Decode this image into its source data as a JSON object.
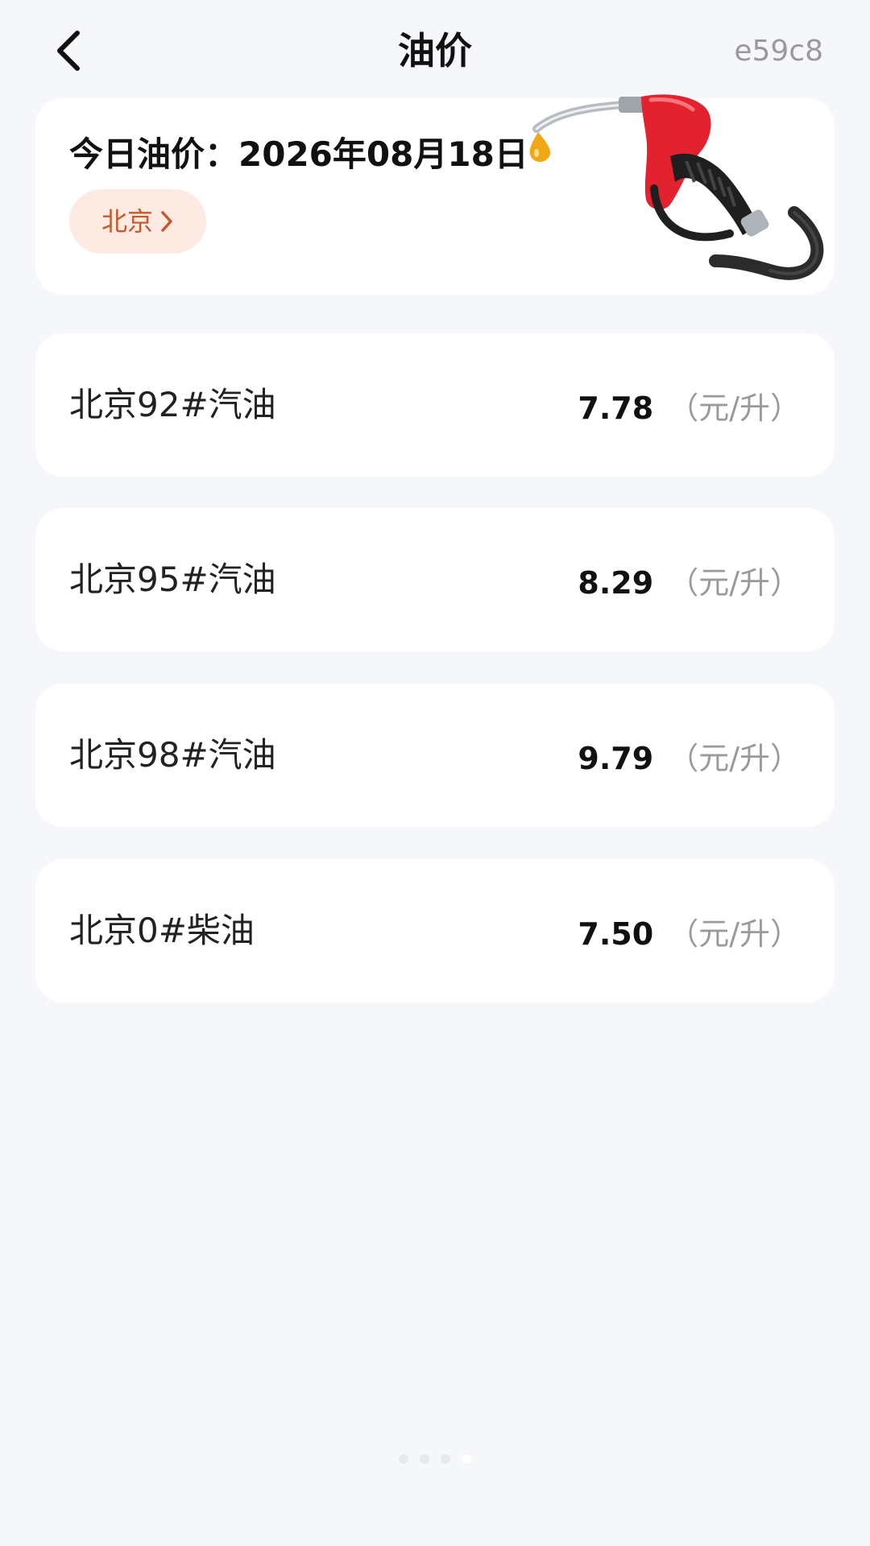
{
  "header": {
    "title": "油价",
    "code": "e59c8"
  },
  "date_card": {
    "date_text": "今日油价：2026年08月18日",
    "city_label": "北京",
    "chip_color": "#fdeae3",
    "chip_text_color": "#c45a2c"
  },
  "prices": [
    {
      "name": "北京92#汽油",
      "price": "7.78",
      "unit": "（元/升）"
    },
    {
      "name": "北京95#汽油",
      "price": "8.29",
      "unit": "（元/升）"
    },
    {
      "name": "北京98#汽油",
      "price": "9.79",
      "unit": "（元/升）"
    },
    {
      "name": "北京0#柴油",
      "price": "7.50",
      "unit": "（元/升）"
    }
  ],
  "page_indicator": {
    "count": 4,
    "active_index": 3
  },
  "icons": {
    "back": "chevron-left-icon",
    "chip_arrow": "chevron-right-icon",
    "decoration": "fuel-nozzle-icon"
  }
}
